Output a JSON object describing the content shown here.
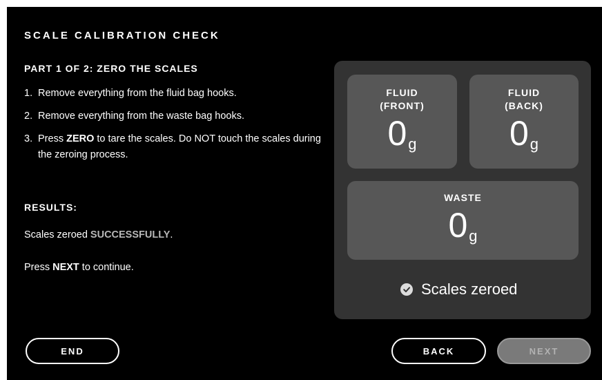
{
  "header": {
    "title": "SCALE CALIBRATION CHECK",
    "part": "PART 1 OF 2: ZERO THE SCALES"
  },
  "steps": [
    {
      "num": "1.",
      "pre": "Remove everything from the fluid bag hooks.",
      "bold": "",
      "post": ""
    },
    {
      "num": "2.",
      "pre": "Remove everything from the waste bag hooks.",
      "bold": "",
      "post": ""
    },
    {
      "num": "3.",
      "pre": "Press ",
      "bold": "ZERO",
      "post": " to tare the scales. Do NOT touch the scales during the zeroing process."
    }
  ],
  "results": {
    "heading": "RESULTS:",
    "line_pre": "Scales zeroed ",
    "line_status": "SUCCESSFULLY",
    "line_post": ".",
    "next_pre": "Press ",
    "next_bold": "NEXT",
    "next_post": " to continue."
  },
  "scales": {
    "front": {
      "label_1": "FLUID",
      "label_2": "(FRONT)",
      "value": "0",
      "unit": "g"
    },
    "back": {
      "label_1": "FLUID",
      "label_2": "(BACK)",
      "value": "0",
      "unit": "g"
    },
    "waste": {
      "label": "WASTE",
      "value": "0",
      "unit": "g"
    },
    "status": "Scales zeroed",
    "status_icon": "check-circle-icon"
  },
  "buttons": {
    "end": "END",
    "back": "BACK",
    "next": "NEXT"
  },
  "colors": {
    "background": "#000000",
    "panel": "#333333",
    "tile": "#575757",
    "success_text": "#b8b8b8",
    "next_disabled": "#7a7a7a"
  }
}
